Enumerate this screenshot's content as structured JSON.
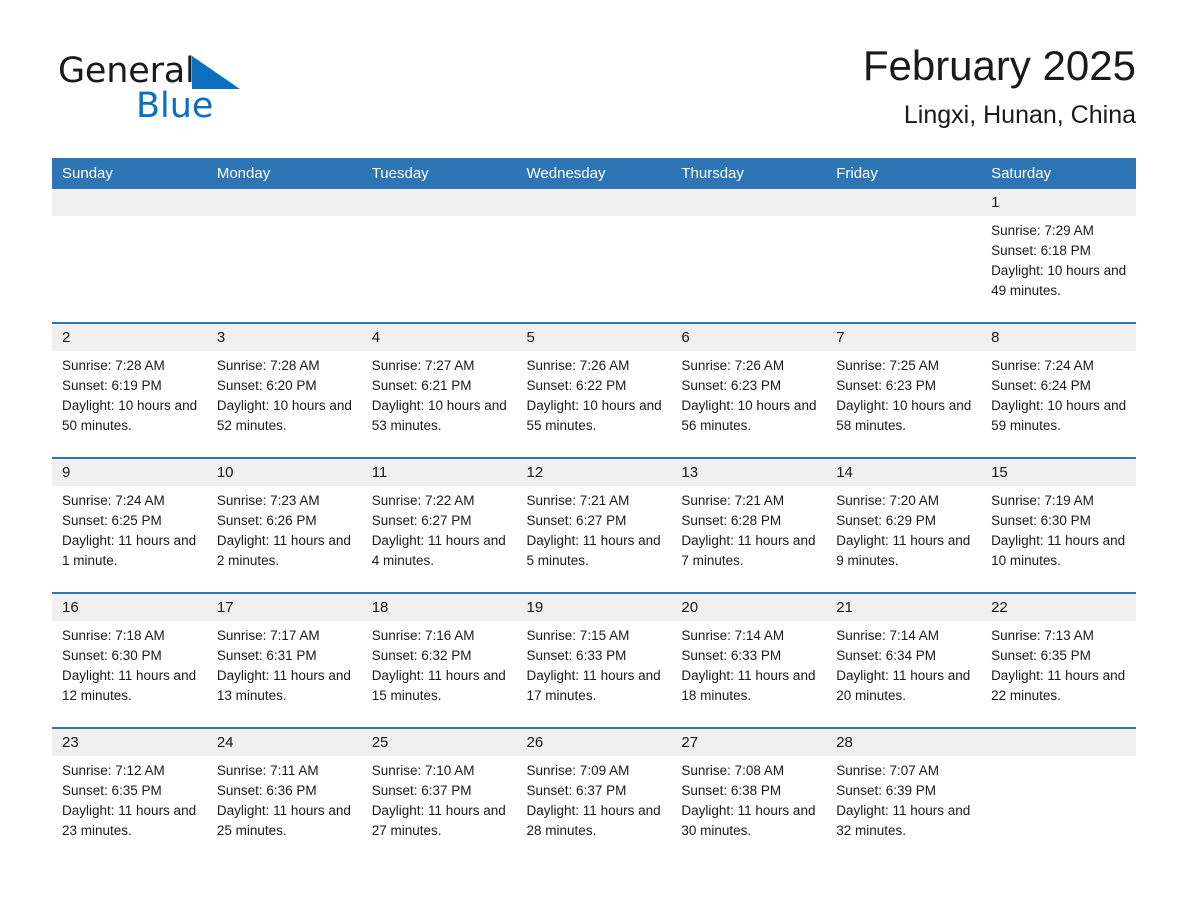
{
  "brand": {
    "word1": "General",
    "word2": "Blue",
    "accent_color": "#0B6FC0"
  },
  "header": {
    "title": "February 2025",
    "subtitle": "Lingxi, Hunan, China"
  },
  "theme": {
    "header_blue": "#2E75B6",
    "daynum_gray": "#F0F0F0"
  },
  "weekdays": [
    "Sunday",
    "Monday",
    "Tuesday",
    "Wednesday",
    "Thursday",
    "Friday",
    "Saturday"
  ],
  "weeks": [
    [
      {
        "day": "",
        "empty": true
      },
      {
        "day": "",
        "empty": true
      },
      {
        "day": "",
        "empty": true
      },
      {
        "day": "",
        "empty": true
      },
      {
        "day": "",
        "empty": true
      },
      {
        "day": "",
        "empty": true
      },
      {
        "day": "1",
        "sunrise": "Sunrise: 7:29 AM",
        "sunset": "Sunset: 6:18 PM",
        "daylight": "Daylight: 10 hours and 49 minutes."
      }
    ],
    [
      {
        "day": "2",
        "sunrise": "Sunrise: 7:28 AM",
        "sunset": "Sunset: 6:19 PM",
        "daylight": "Daylight: 10 hours and 50 minutes."
      },
      {
        "day": "3",
        "sunrise": "Sunrise: 7:28 AM",
        "sunset": "Sunset: 6:20 PM",
        "daylight": "Daylight: 10 hours and 52 minutes."
      },
      {
        "day": "4",
        "sunrise": "Sunrise: 7:27 AM",
        "sunset": "Sunset: 6:21 PM",
        "daylight": "Daylight: 10 hours and 53 minutes."
      },
      {
        "day": "5",
        "sunrise": "Sunrise: 7:26 AM",
        "sunset": "Sunset: 6:22 PM",
        "daylight": "Daylight: 10 hours and 55 minutes."
      },
      {
        "day": "6",
        "sunrise": "Sunrise: 7:26 AM",
        "sunset": "Sunset: 6:23 PM",
        "daylight": "Daylight: 10 hours and 56 minutes."
      },
      {
        "day": "7",
        "sunrise": "Sunrise: 7:25 AM",
        "sunset": "Sunset: 6:23 PM",
        "daylight": "Daylight: 10 hours and 58 minutes."
      },
      {
        "day": "8",
        "sunrise": "Sunrise: 7:24 AM",
        "sunset": "Sunset: 6:24 PM",
        "daylight": "Daylight: 10 hours and 59 minutes."
      }
    ],
    [
      {
        "day": "9",
        "sunrise": "Sunrise: 7:24 AM",
        "sunset": "Sunset: 6:25 PM",
        "daylight": "Daylight: 11 hours and 1 minute."
      },
      {
        "day": "10",
        "sunrise": "Sunrise: 7:23 AM",
        "sunset": "Sunset: 6:26 PM",
        "daylight": "Daylight: 11 hours and 2 minutes."
      },
      {
        "day": "11",
        "sunrise": "Sunrise: 7:22 AM",
        "sunset": "Sunset: 6:27 PM",
        "daylight": "Daylight: 11 hours and 4 minutes."
      },
      {
        "day": "12",
        "sunrise": "Sunrise: 7:21 AM",
        "sunset": "Sunset: 6:27 PM",
        "daylight": "Daylight: 11 hours and 5 minutes."
      },
      {
        "day": "13",
        "sunrise": "Sunrise: 7:21 AM",
        "sunset": "Sunset: 6:28 PM",
        "daylight": "Daylight: 11 hours and 7 minutes."
      },
      {
        "day": "14",
        "sunrise": "Sunrise: 7:20 AM",
        "sunset": "Sunset: 6:29 PM",
        "daylight": "Daylight: 11 hours and 9 minutes."
      },
      {
        "day": "15",
        "sunrise": "Sunrise: 7:19 AM",
        "sunset": "Sunset: 6:30 PM",
        "daylight": "Daylight: 11 hours and 10 minutes."
      }
    ],
    [
      {
        "day": "16",
        "sunrise": "Sunrise: 7:18 AM",
        "sunset": "Sunset: 6:30 PM",
        "daylight": "Daylight: 11 hours and 12 minutes."
      },
      {
        "day": "17",
        "sunrise": "Sunrise: 7:17 AM",
        "sunset": "Sunset: 6:31 PM",
        "daylight": "Daylight: 11 hours and 13 minutes."
      },
      {
        "day": "18",
        "sunrise": "Sunrise: 7:16 AM",
        "sunset": "Sunset: 6:32 PM",
        "daylight": "Daylight: 11 hours and 15 minutes."
      },
      {
        "day": "19",
        "sunrise": "Sunrise: 7:15 AM",
        "sunset": "Sunset: 6:33 PM",
        "daylight": "Daylight: 11 hours and 17 minutes."
      },
      {
        "day": "20",
        "sunrise": "Sunrise: 7:14 AM",
        "sunset": "Sunset: 6:33 PM",
        "daylight": "Daylight: 11 hours and 18 minutes."
      },
      {
        "day": "21",
        "sunrise": "Sunrise: 7:14 AM",
        "sunset": "Sunset: 6:34 PM",
        "daylight": "Daylight: 11 hours and 20 minutes."
      },
      {
        "day": "22",
        "sunrise": "Sunrise: 7:13 AM",
        "sunset": "Sunset: 6:35 PM",
        "daylight": "Daylight: 11 hours and 22 minutes."
      }
    ],
    [
      {
        "day": "23",
        "sunrise": "Sunrise: 7:12 AM",
        "sunset": "Sunset: 6:35 PM",
        "daylight": "Daylight: 11 hours and 23 minutes."
      },
      {
        "day": "24",
        "sunrise": "Sunrise: 7:11 AM",
        "sunset": "Sunset: 6:36 PM",
        "daylight": "Daylight: 11 hours and 25 minutes."
      },
      {
        "day": "25",
        "sunrise": "Sunrise: 7:10 AM",
        "sunset": "Sunset: 6:37 PM",
        "daylight": "Daylight: 11 hours and 27 minutes."
      },
      {
        "day": "26",
        "sunrise": "Sunrise: 7:09 AM",
        "sunset": "Sunset: 6:37 PM",
        "daylight": "Daylight: 11 hours and 28 minutes."
      },
      {
        "day": "27",
        "sunrise": "Sunrise: 7:08 AM",
        "sunset": "Sunset: 6:38 PM",
        "daylight": "Daylight: 11 hours and 30 minutes."
      },
      {
        "day": "28",
        "sunrise": "Sunrise: 7:07 AM",
        "sunset": "Sunset: 6:39 PM",
        "daylight": "Daylight: 11 hours and 32 minutes."
      },
      {
        "day": "",
        "empty": true
      }
    ]
  ]
}
